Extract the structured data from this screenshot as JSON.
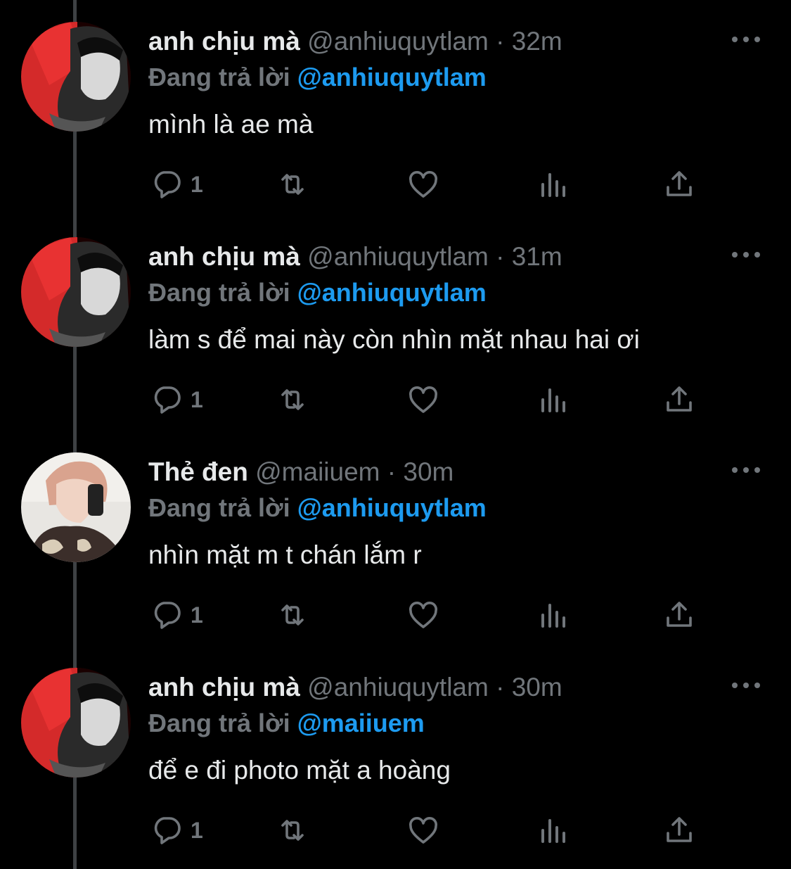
{
  "reply_prefix": "Đang trả lời",
  "tweets": [
    {
      "name": "anh chịu mà",
      "handle": "@anhiuquytlam",
      "sep": "·",
      "time": "32m",
      "reply_to": "@anhiuquytlam",
      "text": "mình là ae mà",
      "reply_count": "1",
      "avatar": "avatar-red"
    },
    {
      "name": "anh chịu mà",
      "handle": "@anhiuquytlam",
      "sep": "·",
      "time": "31m",
      "reply_to": "@anhiuquytlam",
      "text": "làm s để mai này còn nhìn mặt nhau hai ơi",
      "reply_count": "1",
      "avatar": "avatar-red"
    },
    {
      "name": "Thẻ đen",
      "handle": "@maiiuem",
      "sep": "·",
      "time": "30m",
      "reply_to": "@anhiuquytlam",
      "text": "nhìn mặt m t chán lắm r",
      "reply_count": "1",
      "avatar": "avatar-light"
    },
    {
      "name": "anh chịu mà",
      "handle": "@anhiuquytlam",
      "sep": "·",
      "time": "30m",
      "reply_to": "@maiiuem",
      "text": "để e đi photo mặt a hoàng",
      "reply_count": "1",
      "avatar": "avatar-red"
    }
  ],
  "colors": {
    "background": "#000000",
    "text": "#e7e9ea",
    "muted": "#71767b",
    "mention": "#1d9bf0",
    "thread_line": "#3e4144"
  },
  "icons": [
    "reply-icon",
    "retweet-icon",
    "like-icon",
    "views-icon",
    "share-icon",
    "more-icon"
  ]
}
